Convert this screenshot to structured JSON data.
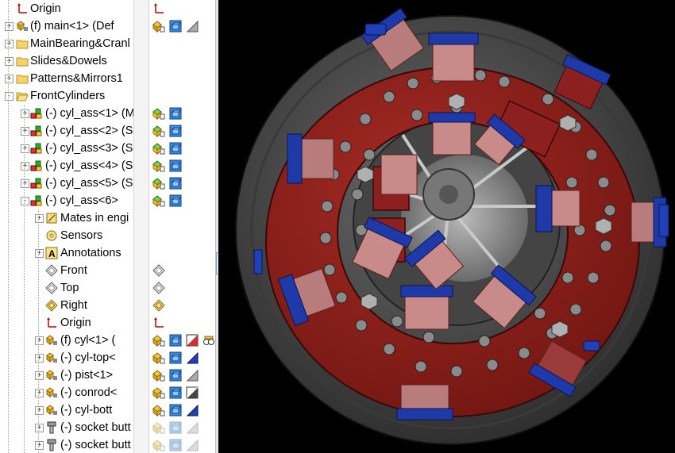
{
  "tree": {
    "rows": [
      {
        "label": "Origin",
        "icon": "origin-icon",
        "expander": "",
        "indent": 0
      },
      {
        "label": "(f) main<1> (Def",
        "icon": "part-icon",
        "expander": "+",
        "indent": 0
      },
      {
        "label": "MainBearing&Cranl",
        "icon": "folder-icon",
        "expander": "+",
        "indent": 0
      },
      {
        "label": "Slides&Dowels",
        "icon": "folder-icon",
        "expander": "+",
        "indent": 0
      },
      {
        "label": "Patterns&Mirrors1",
        "icon": "folder-icon",
        "expander": "+",
        "indent": 0
      },
      {
        "label": "FrontCylinders",
        "icon": "open-folder-icon",
        "expander": "-",
        "indent": 0
      },
      {
        "label": "(-) cyl_ass<1> (M",
        "icon": "subassembly-icon",
        "expander": "+",
        "indent": 1
      },
      {
        "label": "(-) cyl_ass<2> (S",
        "icon": "subassembly-icon",
        "expander": "+",
        "indent": 1
      },
      {
        "label": "(-) cyl_ass<3> (S",
        "icon": "subassembly-icon",
        "expander": "+",
        "indent": 1
      },
      {
        "label": "(-) cyl_ass<4> (S",
        "icon": "subassembly-icon",
        "expander": "+",
        "indent": 1
      },
      {
        "label": "(-) cyl_ass<5> (S",
        "icon": "subassembly-icon",
        "expander": "+",
        "indent": 1
      },
      {
        "label": "(-) cyl_ass<6>",
        "icon": "subassembly-icon",
        "expander": "-",
        "indent": 1
      },
      {
        "label": "Mates in engi",
        "icon": "mates-icon",
        "expander": "+",
        "indent": 2
      },
      {
        "label": "Sensors",
        "icon": "sensors-icon",
        "expander": "",
        "indent": 2
      },
      {
        "label": "Annotations",
        "icon": "annotations-icon",
        "expander": "+",
        "indent": 2
      },
      {
        "label": "Front",
        "icon": "plane-icon",
        "expander": "",
        "indent": 2
      },
      {
        "label": "Top",
        "icon": "plane-icon",
        "expander": "",
        "indent": 2
      },
      {
        "label": "Right",
        "icon": "plane-selected-icon",
        "expander": "",
        "indent": 2
      },
      {
        "label": "Origin",
        "icon": "origin-icon",
        "expander": "",
        "indent": 2
      },
      {
        "label": "(f) cyl<1> (",
        "icon": "part-icon",
        "expander": "+",
        "indent": 2
      },
      {
        "label": "(-) cyl-top<",
        "icon": "part-icon",
        "expander": "+",
        "indent": 2
      },
      {
        "label": "(-) pist<1>",
        "icon": "part-icon",
        "expander": "+",
        "indent": 2
      },
      {
        "label": "(-) conrod<",
        "icon": "part-icon",
        "expander": "+",
        "indent": 2
      },
      {
        "label": "(-) cyl-bott",
        "icon": "part-icon",
        "expander": "+",
        "indent": 2
      },
      {
        "label": "(-) socket butt",
        "icon": "screw-icon",
        "expander": "+",
        "indent": 2
      },
      {
        "label": "(-) socket butt",
        "icon": "screw-icon",
        "expander": "+",
        "indent": 2
      }
    ]
  },
  "columns": {
    "rows": [
      [
        "origin-icon"
      ],
      [
        "part-state-icon",
        "cube-icon",
        "triangle-icon"
      ],
      [],
      [],
      [],
      [],
      [
        "assembly-state-icon",
        "cube-icon"
      ],
      [
        "assembly-state-icon",
        "cube-icon"
      ],
      [
        "assembly-state-icon",
        "cube-icon"
      ],
      [
        "assembly-state-icon",
        "cube-icon"
      ],
      [
        "assembly-state-icon",
        "cube-icon"
      ],
      [
        "assembly-state-icon",
        "cube-icon"
      ],
      [],
      [],
      [],
      [
        "plane-icon"
      ],
      [
        "plane-icon"
      ],
      [
        "plane-selected-icon"
      ],
      [
        "origin-icon"
      ],
      [
        "part-state-icon",
        "cube-icon",
        "triangle-red-icon",
        "glasses-icon"
      ],
      [
        "part-state-icon",
        "cube-icon",
        "triangle-blue-icon"
      ],
      [
        "part-state-icon",
        "cube-icon",
        "triangle-icon"
      ],
      [
        "part-state-icon",
        "cube-icon",
        "triangle-dark-icon"
      ],
      [
        "part-state-icon",
        "cube-icon",
        "triangle-blue-icon"
      ],
      [
        "part-state-faded-icon",
        "cube-faded-icon",
        "triangle-faded-icon"
      ],
      [
        "part-state-faded-icon",
        "cube-faded-icon",
        "triangle-faded-icon"
      ]
    ]
  },
  "colors": {
    "model_red": "#8b1a1a",
    "model_blue": "#1f3aa8",
    "model_grey": "#5a5a5a",
    "background": "#000000",
    "tree_background": "#ffffff"
  },
  "viewport": {
    "content": "3D engine assembly model"
  }
}
